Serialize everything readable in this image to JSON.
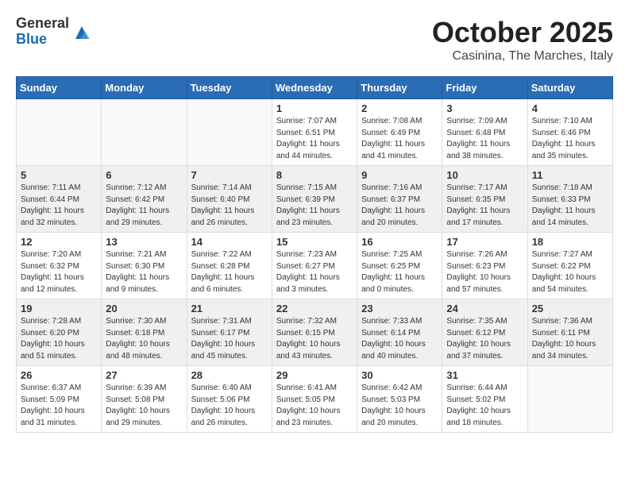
{
  "header": {
    "logo_general": "General",
    "logo_blue": "Blue",
    "month": "October 2025",
    "location": "Casinina, The Marches, Italy"
  },
  "days_of_week": [
    "Sunday",
    "Monday",
    "Tuesday",
    "Wednesday",
    "Thursday",
    "Friday",
    "Saturday"
  ],
  "weeks": [
    [
      {
        "day": "",
        "info": ""
      },
      {
        "day": "",
        "info": ""
      },
      {
        "day": "",
        "info": ""
      },
      {
        "day": "1",
        "info": "Sunrise: 7:07 AM\nSunset: 6:51 PM\nDaylight: 11 hours\nand 44 minutes."
      },
      {
        "day": "2",
        "info": "Sunrise: 7:08 AM\nSunset: 6:49 PM\nDaylight: 11 hours\nand 41 minutes."
      },
      {
        "day": "3",
        "info": "Sunrise: 7:09 AM\nSunset: 6:48 PM\nDaylight: 11 hours\nand 38 minutes."
      },
      {
        "day": "4",
        "info": "Sunrise: 7:10 AM\nSunset: 6:46 PM\nDaylight: 11 hours\nand 35 minutes."
      }
    ],
    [
      {
        "day": "5",
        "info": "Sunrise: 7:11 AM\nSunset: 6:44 PM\nDaylight: 11 hours\nand 32 minutes."
      },
      {
        "day": "6",
        "info": "Sunrise: 7:12 AM\nSunset: 6:42 PM\nDaylight: 11 hours\nand 29 minutes."
      },
      {
        "day": "7",
        "info": "Sunrise: 7:14 AM\nSunset: 6:40 PM\nDaylight: 11 hours\nand 26 minutes."
      },
      {
        "day": "8",
        "info": "Sunrise: 7:15 AM\nSunset: 6:39 PM\nDaylight: 11 hours\nand 23 minutes."
      },
      {
        "day": "9",
        "info": "Sunrise: 7:16 AM\nSunset: 6:37 PM\nDaylight: 11 hours\nand 20 minutes."
      },
      {
        "day": "10",
        "info": "Sunrise: 7:17 AM\nSunset: 6:35 PM\nDaylight: 11 hours\nand 17 minutes."
      },
      {
        "day": "11",
        "info": "Sunrise: 7:18 AM\nSunset: 6:33 PM\nDaylight: 11 hours\nand 14 minutes."
      }
    ],
    [
      {
        "day": "12",
        "info": "Sunrise: 7:20 AM\nSunset: 6:32 PM\nDaylight: 11 hours\nand 12 minutes."
      },
      {
        "day": "13",
        "info": "Sunrise: 7:21 AM\nSunset: 6:30 PM\nDaylight: 11 hours\nand 9 minutes."
      },
      {
        "day": "14",
        "info": "Sunrise: 7:22 AM\nSunset: 6:28 PM\nDaylight: 11 hours\nand 6 minutes."
      },
      {
        "day": "15",
        "info": "Sunrise: 7:23 AM\nSunset: 6:27 PM\nDaylight: 11 hours\nand 3 minutes."
      },
      {
        "day": "16",
        "info": "Sunrise: 7:25 AM\nSunset: 6:25 PM\nDaylight: 11 hours\nand 0 minutes."
      },
      {
        "day": "17",
        "info": "Sunrise: 7:26 AM\nSunset: 6:23 PM\nDaylight: 10 hours\nand 57 minutes."
      },
      {
        "day": "18",
        "info": "Sunrise: 7:27 AM\nSunset: 6:22 PM\nDaylight: 10 hours\nand 54 minutes."
      }
    ],
    [
      {
        "day": "19",
        "info": "Sunrise: 7:28 AM\nSunset: 6:20 PM\nDaylight: 10 hours\nand 51 minutes."
      },
      {
        "day": "20",
        "info": "Sunrise: 7:30 AM\nSunset: 6:18 PM\nDaylight: 10 hours\nand 48 minutes."
      },
      {
        "day": "21",
        "info": "Sunrise: 7:31 AM\nSunset: 6:17 PM\nDaylight: 10 hours\nand 45 minutes."
      },
      {
        "day": "22",
        "info": "Sunrise: 7:32 AM\nSunset: 6:15 PM\nDaylight: 10 hours\nand 43 minutes."
      },
      {
        "day": "23",
        "info": "Sunrise: 7:33 AM\nSunset: 6:14 PM\nDaylight: 10 hours\nand 40 minutes."
      },
      {
        "day": "24",
        "info": "Sunrise: 7:35 AM\nSunset: 6:12 PM\nDaylight: 10 hours\nand 37 minutes."
      },
      {
        "day": "25",
        "info": "Sunrise: 7:36 AM\nSunset: 6:11 PM\nDaylight: 10 hours\nand 34 minutes."
      }
    ],
    [
      {
        "day": "26",
        "info": "Sunrise: 6:37 AM\nSunset: 5:09 PM\nDaylight: 10 hours\nand 31 minutes."
      },
      {
        "day": "27",
        "info": "Sunrise: 6:39 AM\nSunset: 5:08 PM\nDaylight: 10 hours\nand 29 minutes."
      },
      {
        "day": "28",
        "info": "Sunrise: 6:40 AM\nSunset: 5:06 PM\nDaylight: 10 hours\nand 26 minutes."
      },
      {
        "day": "29",
        "info": "Sunrise: 6:41 AM\nSunset: 5:05 PM\nDaylight: 10 hours\nand 23 minutes."
      },
      {
        "day": "30",
        "info": "Sunrise: 6:42 AM\nSunset: 5:03 PM\nDaylight: 10 hours\nand 20 minutes."
      },
      {
        "day": "31",
        "info": "Sunrise: 6:44 AM\nSunset: 5:02 PM\nDaylight: 10 hours\nand 18 minutes."
      },
      {
        "day": "",
        "info": ""
      }
    ]
  ]
}
